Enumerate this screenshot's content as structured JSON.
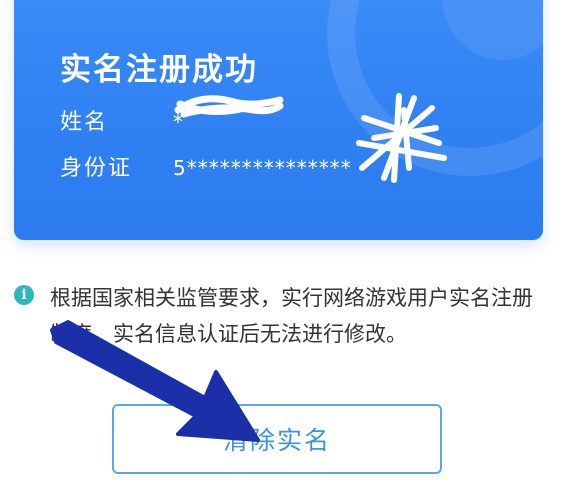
{
  "card": {
    "title": "实名注册成功",
    "name_label": "姓名",
    "name_value": "*",
    "id_label": "身份证",
    "id_value": "5***************"
  },
  "notice": {
    "icon": "info-icon",
    "text": "根据国家相关监管要求，实行网络游戏用户实名注册制度，实名信息认证后无法进行修改。"
  },
  "actions": {
    "clear_label": "清除实名"
  },
  "colors": {
    "card_blue": "#2f80f2",
    "button_border": "#5aa9dd",
    "button_text": "#3d95d3",
    "info_icon": "#2fb6b6",
    "annotation_arrow": "#1a2fa8"
  }
}
